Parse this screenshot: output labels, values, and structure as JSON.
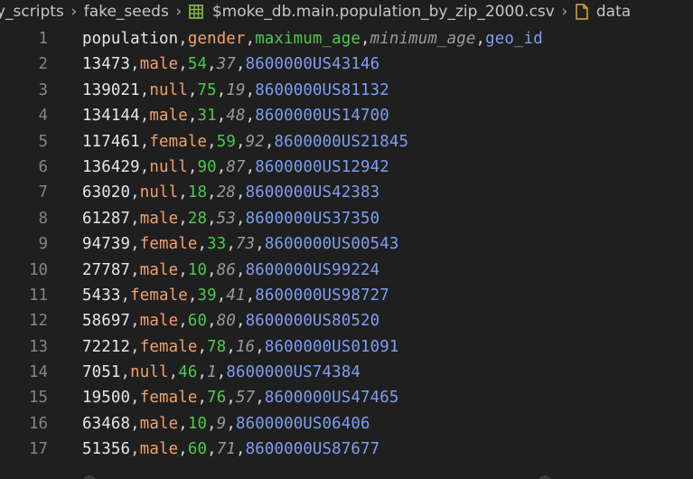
{
  "breadcrumb": {
    "items": [
      {
        "label": "y_scripts",
        "kind": "folder"
      },
      {
        "label": "fake_seeds",
        "kind": "folder"
      },
      {
        "label": "$moke_db.main.population_by_zip_2000.csv",
        "kind": "csv-file",
        "icon": "csv-table-icon"
      },
      {
        "label": "data",
        "kind": "symbol",
        "icon": "file-icon"
      }
    ],
    "separator": "›"
  },
  "colors": {
    "column_1": "#e6e6e6",
    "column_2": "#f2a26b",
    "column_3": "#4ec94e",
    "column_4": "#9a9a9a",
    "column_5": "#7f9ef0",
    "background": "#1f1f1f",
    "line_number": "#858585"
  },
  "editor": {
    "lines": [
      {
        "num": "1",
        "cells": [
          "population",
          "gender",
          "maximum_age",
          "minimum_age",
          "geo_id"
        ]
      },
      {
        "num": "2",
        "cells": [
          "13473",
          "male",
          "54",
          "37",
          "8600000US43146"
        ]
      },
      {
        "num": "3",
        "cells": [
          "139021",
          "null",
          "75",
          "19",
          "8600000US81132"
        ]
      },
      {
        "num": "4",
        "cells": [
          "134144",
          "male",
          "31",
          "48",
          "8600000US14700"
        ]
      },
      {
        "num": "5",
        "cells": [
          "117461",
          "female",
          "59",
          "92",
          "8600000US21845"
        ]
      },
      {
        "num": "6",
        "cells": [
          "136429",
          "null",
          "90",
          "87",
          "8600000US12942"
        ]
      },
      {
        "num": "7",
        "cells": [
          "63020",
          "null",
          "18",
          "28",
          "8600000US42383"
        ]
      },
      {
        "num": "8",
        "cells": [
          "61287",
          "male",
          "28",
          "53",
          "8600000US37350"
        ]
      },
      {
        "num": "9",
        "cells": [
          "94739",
          "female",
          "33",
          "73",
          "8600000US00543"
        ]
      },
      {
        "num": "10",
        "cells": [
          "27787",
          "male",
          "10",
          "86",
          "8600000US99224"
        ]
      },
      {
        "num": "11",
        "cells": [
          "5433",
          "female",
          "39",
          "41",
          "8600000US98727"
        ]
      },
      {
        "num": "12",
        "cells": [
          "58697",
          "male",
          "60",
          "80",
          "8600000US80520"
        ]
      },
      {
        "num": "13",
        "cells": [
          "72212",
          "female",
          "78",
          "16",
          "8600000US01091"
        ]
      },
      {
        "num": "14",
        "cells": [
          "7051",
          "null",
          "46",
          "1",
          "8600000US74384"
        ]
      },
      {
        "num": "15",
        "cells": [
          "19500",
          "female",
          "76",
          "57",
          "8600000US47465"
        ]
      },
      {
        "num": "16",
        "cells": [
          "63468",
          "male",
          "10",
          "9",
          "8600000US06406"
        ]
      },
      {
        "num": "17",
        "cells": [
          "51356",
          "male",
          "60",
          "71",
          "8600000US87677"
        ]
      }
    ]
  }
}
